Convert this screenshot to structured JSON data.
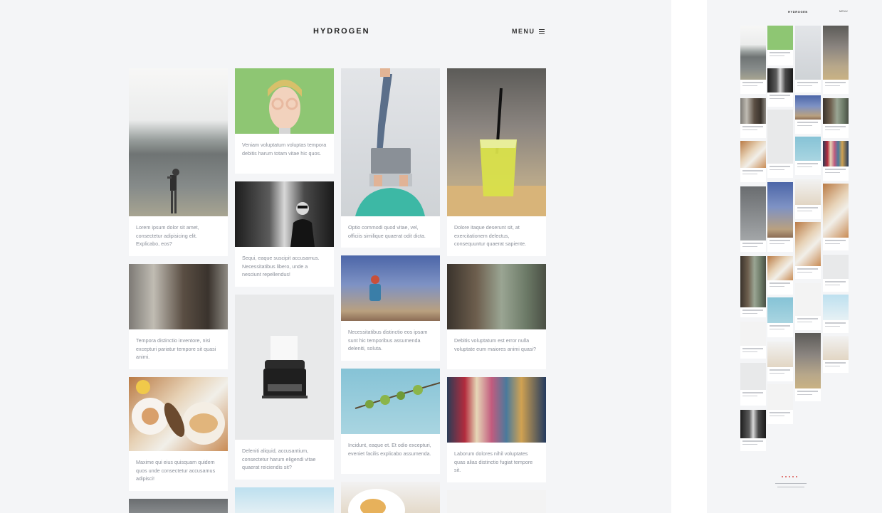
{
  "header": {
    "logo": "HYDROGEN",
    "menu_label": "MENU"
  },
  "posts": [
    {
      "caption": "Lorem ipsum dolor sit amet, consectetur adipisicing elit. Explicabo, eos?"
    },
    {
      "caption": "Tempora distinctio inventore, nisi excepturi pariatur tempore sit quasi animi."
    },
    {
      "caption": "Maxime qui eius quisquam quidem quos unde consectetur accusamus adipisci!"
    },
    {
      "caption": "Veniam voluptatum voluptas tempora debitis harum totam vitae hic quos."
    },
    {
      "caption": "Sequi, eaque suscipit accusamus. Necessitatibus libero, unde a nesciunt repellendus!"
    },
    {
      "caption": "Deleniti aliquid, accusantium, consectetur harum eligendi vitae quaerat reiciendis sit?"
    },
    {
      "caption": "Optio commodi quod vitae, vel, officiis similique quaerat odit dicta."
    },
    {
      "caption": "Necessitatibus distinctio eos ipsam sunt hic temporibus assumenda deleniti, soluta."
    },
    {
      "caption": "Incidunt, eaque et. Et odio excepturi, eveniet facilis explicabo assumenda."
    },
    {
      "caption": "Dolore itaque deserunt sit, at exercitationem delectus, consequuntur quaerat sapiente."
    },
    {
      "caption": "Debitis voluptatum est error nulla voluptate eum maiores animi quasi?"
    },
    {
      "caption": "Laborum dolores nihil voluptates quas alias distinctio fugiat tempore sit."
    }
  ],
  "preview": {
    "logo": "HYDROGEN",
    "menu_label": "MENU"
  },
  "colors": {
    "background": "#f4f5f7",
    "card": "#ffffff",
    "caption_text": "#8a8f99",
    "logo_text": "#222222",
    "footer_accent": "#d9534f"
  }
}
